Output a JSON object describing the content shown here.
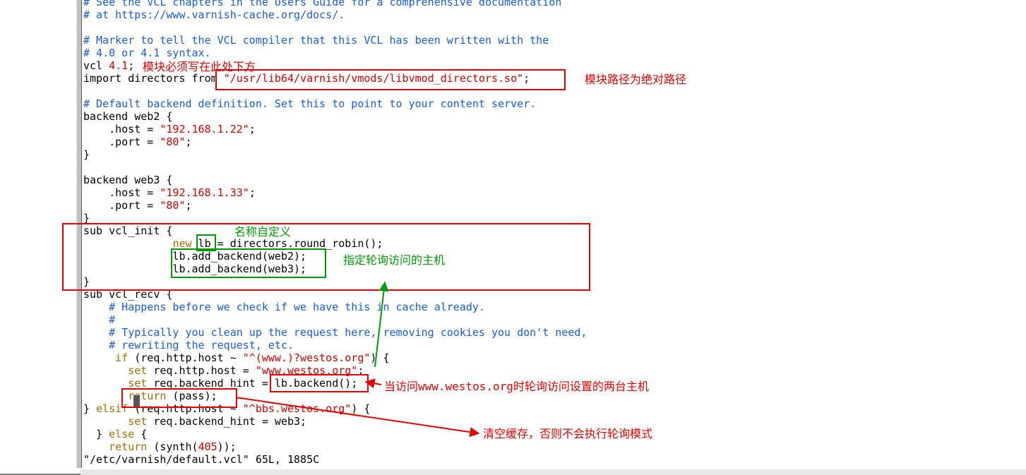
{
  "code_lines": [
    {
      "cls": "comment",
      "text": "# See the VCL chapters in the Users Guide for a comprehensive documentation"
    },
    {
      "cls": "comment",
      "text": "# at https://www.varnish-cache.org/docs/."
    },
    {
      "cls": "",
      "text": ""
    },
    {
      "cls": "comment",
      "text": "# Marker to tell the VCL compiler that this VCL has been written with the"
    },
    {
      "cls": "comment",
      "text": "# 4.0 or 4.1 syntax."
    },
    {
      "cls": "mixed",
      "parts": [
        [
          "vcl ",
          ""
        ],
        [
          "4.1",
          "string"
        ],
        [
          ";",
          ""
        ]
      ]
    },
    {
      "cls": "mixed",
      "parts": [
        [
          "import",
          ""
        ],
        [
          " directors ",
          ""
        ],
        [
          "from",
          ""
        ],
        [
          " ",
          ""
        ],
        [
          "\"/usr/lib64/varnish/vmods/libvmod_directors.so\"",
          "string"
        ],
        [
          ";",
          ""
        ]
      ]
    },
    {
      "cls": "",
      "text": ""
    },
    {
      "cls": "comment",
      "text": "# Default backend definition. Set this to point to your content server."
    },
    {
      "cls": "mixed",
      "parts": [
        [
          "backend",
          ""
        ],
        [
          " web2 {",
          ""
        ]
      ]
    },
    {
      "cls": "mixed",
      "parts": [
        [
          "    .host = ",
          ""
        ],
        [
          "\"192.168.1.22\"",
          "string"
        ],
        [
          ";",
          ""
        ]
      ]
    },
    {
      "cls": "mixed",
      "parts": [
        [
          "    .port = ",
          ""
        ],
        [
          "\"80\"",
          "string"
        ],
        [
          ";",
          ""
        ]
      ]
    },
    {
      "cls": "",
      "text": "}"
    },
    {
      "cls": "",
      "text": ""
    },
    {
      "cls": "mixed",
      "parts": [
        [
          "backend",
          ""
        ],
        [
          " web3 {",
          ""
        ]
      ]
    },
    {
      "cls": "mixed",
      "parts": [
        [
          "    .host = ",
          ""
        ],
        [
          "\"192.168.1.33\"",
          "string"
        ],
        [
          ";",
          ""
        ]
      ]
    },
    {
      "cls": "mixed",
      "parts": [
        [
          "    .port = ",
          ""
        ],
        [
          "\"80\"",
          "string"
        ],
        [
          ";",
          ""
        ]
      ]
    },
    {
      "cls": "",
      "text": "}"
    },
    {
      "cls": "mixed",
      "parts": [
        [
          "sub",
          ""
        ],
        [
          " vcl_init {",
          ""
        ]
      ]
    },
    {
      "cls": "mixed",
      "parts": [
        [
          "              ",
          ""
        ],
        [
          "new",
          "statement"
        ],
        [
          " lb = directors.round_robin();",
          ""
        ]
      ]
    },
    {
      "cls": "",
      "text": "              lb.add_backend(web2);"
    },
    {
      "cls": "",
      "text": "              lb.add_backend(web3);"
    },
    {
      "cls": "",
      "text": "}"
    },
    {
      "cls": "mixed",
      "parts": [
        [
          "sub",
          ""
        ],
        [
          " vcl_recv {",
          ""
        ]
      ]
    },
    {
      "cls": "mixed",
      "parts": [
        [
          "    ",
          ""
        ],
        [
          "# Happens before we check if we have this in cache already.",
          "comment"
        ]
      ]
    },
    {
      "cls": "mixed",
      "parts": [
        [
          "    ",
          ""
        ],
        [
          "#",
          "comment"
        ]
      ]
    },
    {
      "cls": "mixed",
      "parts": [
        [
          "    ",
          ""
        ],
        [
          "# Typically you clean up the request here, removing cookies you don't need,",
          "comment"
        ]
      ]
    },
    {
      "cls": "mixed",
      "parts": [
        [
          "    ",
          ""
        ],
        [
          "# rewriting the request, etc.",
          "comment"
        ]
      ]
    },
    {
      "cls": "mixed",
      "parts": [
        [
          "     ",
          ""
        ],
        [
          "if",
          "statement"
        ],
        [
          " (req.http.host ~ ",
          ""
        ],
        [
          "\"^(www.)?westos.org\"",
          "string"
        ],
        [
          ") {",
          ""
        ]
      ]
    },
    {
      "cls": "mixed",
      "parts": [
        [
          "       ",
          ""
        ],
        [
          "set",
          "statement"
        ],
        [
          " req.http.host = ",
          ""
        ],
        [
          "\"www.westos.org\"",
          "string"
        ],
        [
          ";",
          ""
        ]
      ]
    },
    {
      "cls": "mixed",
      "parts": [
        [
          "       ",
          ""
        ],
        [
          "set",
          "statement"
        ],
        [
          " req.backend_hint = lb.backend();",
          ""
        ]
      ]
    },
    {
      "cls": "mixed",
      "parts": [
        [
          "       ",
          ""
        ],
        [
          "return",
          "statement"
        ],
        [
          " (pass);",
          ""
        ]
      ]
    },
    {
      "cls": "mixed",
      "parts": [
        [
          "} ",
          ""
        ],
        [
          "elsif",
          "statement"
        ],
        [
          " (req.http.host ~ ",
          ""
        ],
        [
          "\"^bbs.westos.org\"",
          "string"
        ],
        [
          ") {",
          ""
        ]
      ]
    },
    {
      "cls": "mixed",
      "parts": [
        [
          "       ",
          ""
        ],
        [
          "set",
          "statement"
        ],
        [
          " req.backend_hint = web3;",
          ""
        ]
      ]
    },
    {
      "cls": "mixed",
      "parts": [
        [
          "  } ",
          ""
        ],
        [
          "else",
          "statement"
        ],
        [
          " {",
          ""
        ]
      ]
    },
    {
      "cls": "mixed",
      "parts": [
        [
          "    ",
          ""
        ],
        [
          "return",
          "statement"
        ],
        [
          " (synth(",
          ""
        ],
        [
          "405",
          "string"
        ],
        [
          "));",
          ""
        ]
      ]
    },
    {
      "cls": "",
      "text": "\"/etc/varnish/default.vcl\" 65L, 1885C"
    }
  ],
  "annotations": {
    "a1": "模块必须写在此处下方",
    "a2": "模块路径为绝对路径",
    "a3": "名称自定义",
    "a4": "指定轮询访问的主机",
    "a5": "当访问www.westos.org时轮询访问设置的两台主机",
    "a6": "清空缓存，否则不会执行轮询模式"
  }
}
